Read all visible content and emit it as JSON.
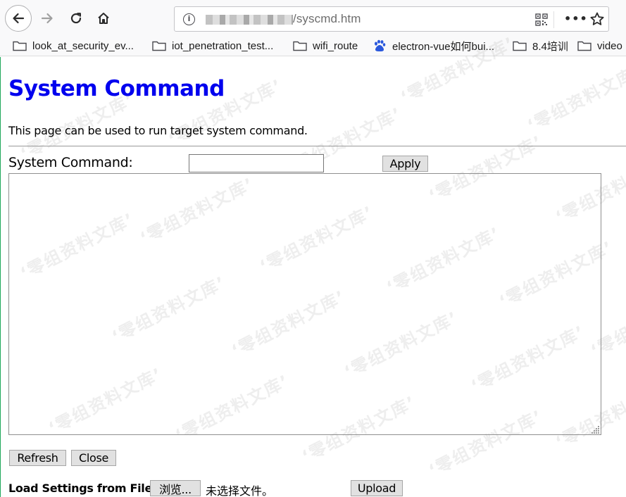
{
  "browser": {
    "url_suffix": "/syscmd.htm",
    "bookmarks": [
      {
        "label": "look_at_security_ev...",
        "icon": "folder-icon"
      },
      {
        "label": "iot_penetration_test...",
        "icon": "folder-icon"
      },
      {
        "label": "wifi_route",
        "icon": "folder-icon"
      },
      {
        "label": "electron-vue如何bui...",
        "icon": "baidu-paw-icon"
      },
      {
        "label": "8.4培训",
        "icon": "folder-icon"
      },
      {
        "label": "video",
        "icon": "folder-icon"
      }
    ]
  },
  "page": {
    "title": "System Command",
    "description": "This page can be used to run target system command.",
    "command_label": "System Command:",
    "command_value": "",
    "apply_label": "Apply",
    "output_text": "",
    "refresh_label": "Refresh",
    "close_label": "Close",
    "load_label": "Load Settings from File:",
    "browse_label": "浏览...",
    "no_file_text": "未选择文件。",
    "upload_label": "Upload",
    "title_color": "#0000ee"
  },
  "watermark": {
    "text": "‘零组资料文库’"
  }
}
